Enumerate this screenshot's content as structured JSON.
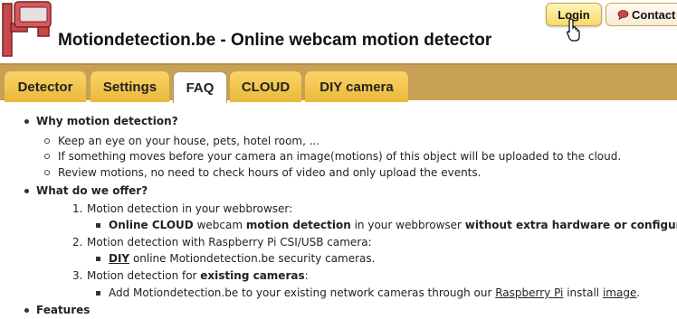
{
  "header": {
    "title": "Motiondetection.be - Online webcam motion detector",
    "login_label": "Login",
    "contact_label": "Contact"
  },
  "tabs": [
    {
      "label": "Detector",
      "active": false
    },
    {
      "label": "Settings",
      "active": false
    },
    {
      "label": "FAQ",
      "active": true
    },
    {
      "label": "CLOUD",
      "active": false
    },
    {
      "label": "DIY camera",
      "active": false
    }
  ],
  "colors": {
    "tabbar": "#c8a056",
    "tab": "#f2c44c",
    "login_button": "#f5d96a",
    "logo_red": "#c8474a"
  },
  "faq": {
    "why": {
      "heading": "Why motion detection?",
      "items": [
        "Keep an eye on your house, pets, hotel room, ...",
        "If something moves before your camera an image(motions) of this object will be uploaded to the cloud.",
        "Review motions, no need to check hours of video and only upload the events."
      ]
    },
    "offer": {
      "heading": "What do we offer?",
      "items": [
        {
          "number": "1.",
          "text": "Motion detection in your webbrowser:",
          "sub": {
            "b1": "Online CLOUD",
            "t1": " webcam ",
            "b2": "motion detection",
            "t2": " in your webbrowser ",
            "b3": "without extra hardware or configuration",
            "t3": "."
          }
        },
        {
          "number": "2.",
          "text": "Motion detection with Raspberry Pi CSI/USB camera:",
          "sub": {
            "link": "DIY",
            "t1": " online Motiondetection.be security cameras."
          }
        },
        {
          "number": "3.",
          "text": "Motion detection for ",
          "bold": "existing cameras",
          "after": ":",
          "sub": {
            "t1": "Add Motiondetection.be to your existing network cameras through our ",
            "link1": "Raspberry Pi",
            "t2": " install ",
            "link2": "image",
            "t3": "."
          }
        }
      ]
    },
    "features": {
      "heading": "Features"
    }
  }
}
